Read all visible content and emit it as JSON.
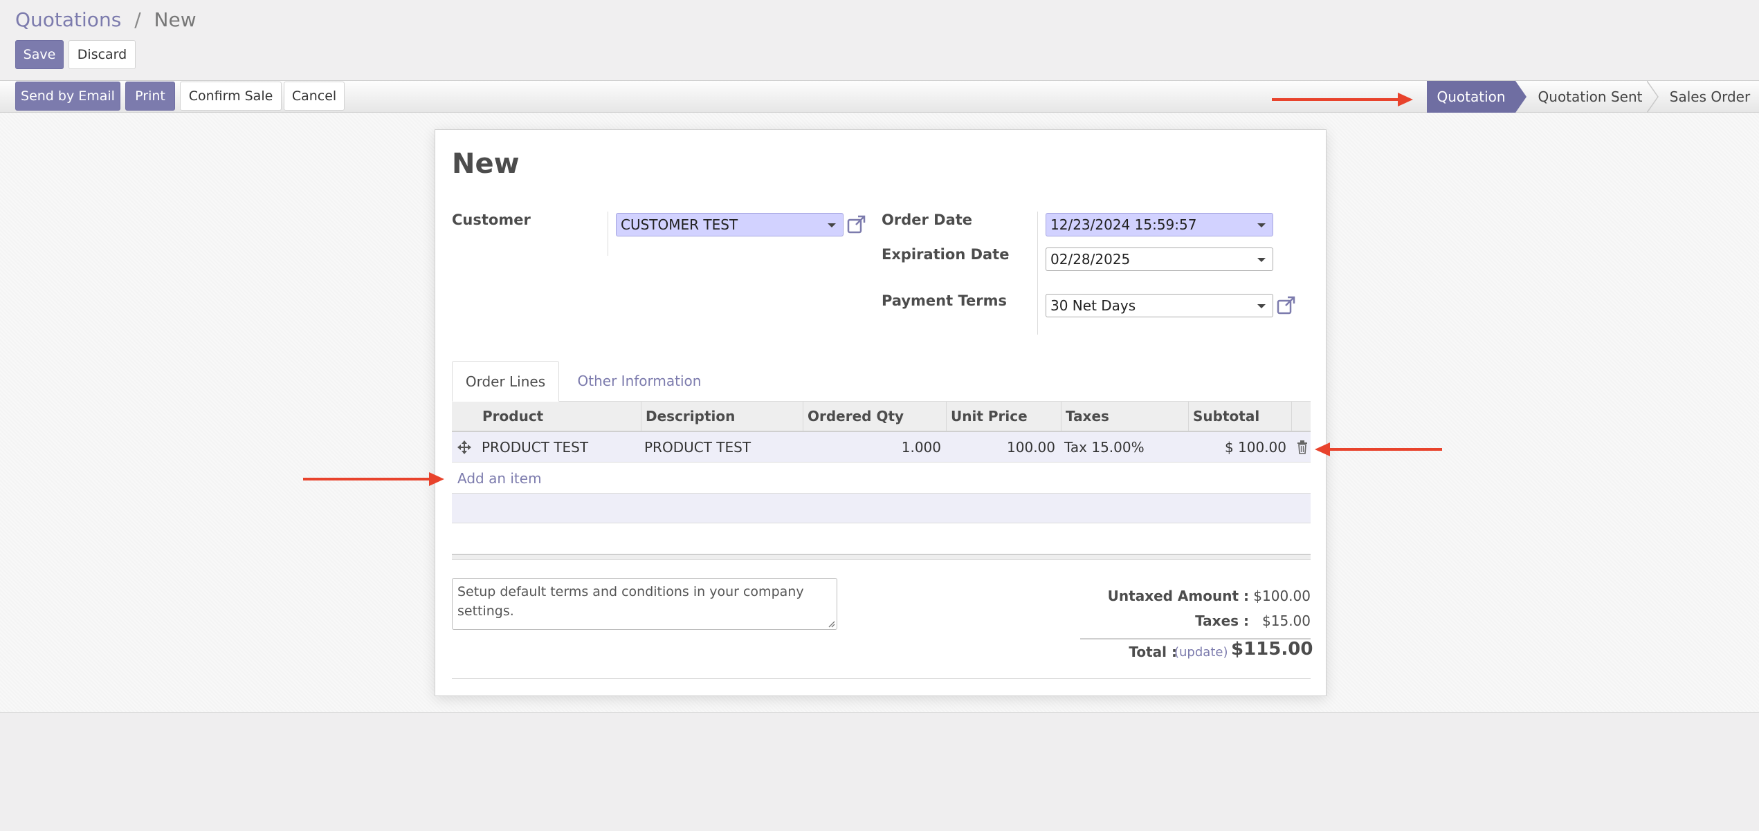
{
  "breadcrumb": {
    "parent": "Quotations",
    "separator": "/",
    "current": "New"
  },
  "buttons": {
    "save": "Save",
    "discard": "Discard"
  },
  "actions": {
    "send_email": "Send by Email",
    "print": "Print",
    "confirm_sale": "Confirm Sale",
    "cancel": "Cancel"
  },
  "statusbar": {
    "stages": [
      "Quotation",
      "Quotation Sent",
      "Sales Order"
    ],
    "active": "Quotation"
  },
  "form": {
    "title": "New",
    "customer": {
      "label": "Customer",
      "value": "CUSTOMER TEST"
    },
    "order_date": {
      "label": "Order Date",
      "value": "12/23/2024 15:59:57"
    },
    "expiration_date": {
      "label": "Expiration Date",
      "value": "02/28/2025"
    },
    "payment_terms": {
      "label": "Payment Terms",
      "value": "30 Net Days"
    }
  },
  "tabs": [
    "Order Lines",
    "Other Information"
  ],
  "order_lines": {
    "columns": [
      "Product",
      "Description",
      "Ordered Qty",
      "Unit Price",
      "Taxes",
      "Subtotal"
    ],
    "rows": [
      {
        "product": "PRODUCT TEST",
        "description": "PRODUCT TEST",
        "qty": "1.000",
        "unit_price": "100.00",
        "taxes": "Tax 15.00%",
        "subtotal": "$ 100.00"
      }
    ],
    "add_item": "Add an item"
  },
  "notes": "Setup default terms and conditions in your company settings.",
  "totals": {
    "untaxed_label": "Untaxed Amount :",
    "untaxed_value": "$100.00",
    "taxes_label": "Taxes :",
    "taxes_value": "$15.00",
    "total_label": "Total :",
    "update_link": "(update)",
    "total_value": "$115.00"
  },
  "colors": {
    "primary": "#7c7bad",
    "active_stage": "#6f6ea2",
    "annotation_arrow": "#e8432c",
    "required_field": "#d2d2ff"
  },
  "icons": [
    "external-link-icon",
    "drag-handle-icon",
    "trash-icon",
    "dropdown-caret-icon",
    "annotation-arrow"
  ]
}
